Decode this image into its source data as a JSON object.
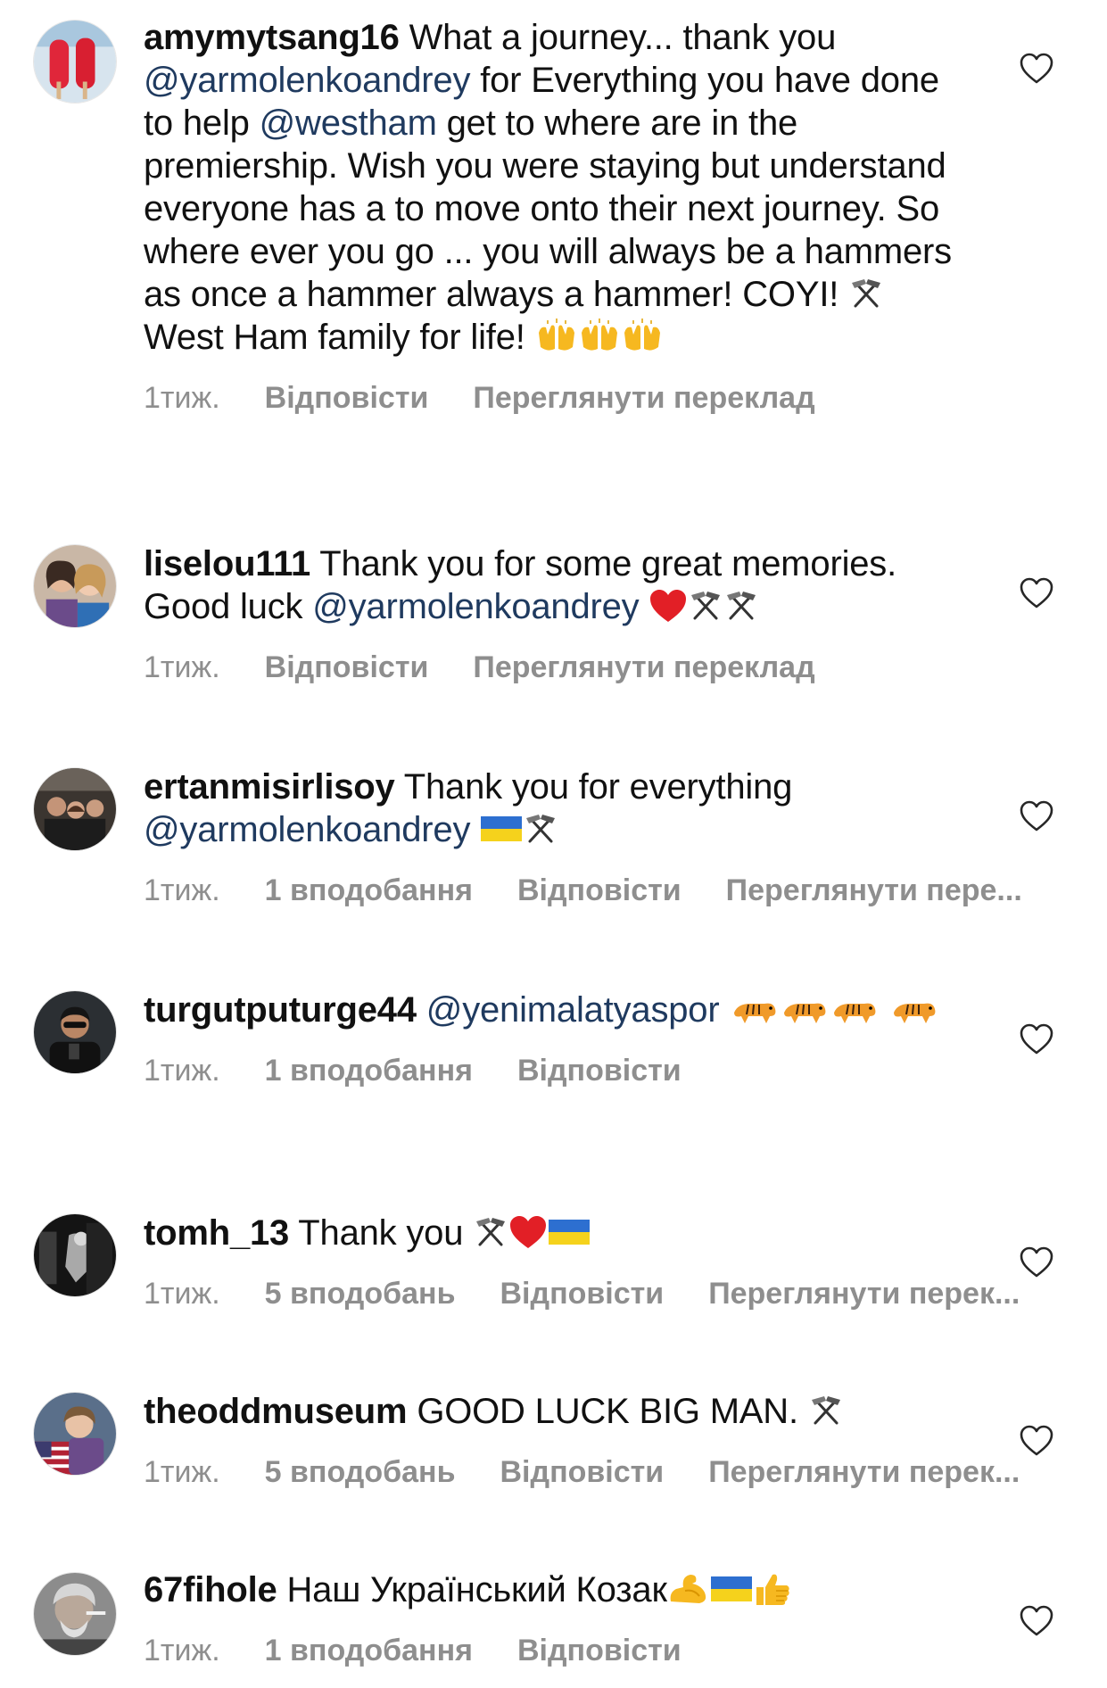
{
  "colors": {
    "text": "#111111",
    "mention": "#1f3a5f",
    "meta": "#8e8e8e",
    "heart_outline": "#262626"
  },
  "comments": [
    {
      "username": "amymytsang16",
      "parts": [
        {
          "t": "text",
          "v": " What a journey... thank you "
        },
        {
          "t": "mention",
          "v": "@yarmolenkoandrey"
        },
        {
          "t": "text",
          "v": " for Everything you have done to help "
        },
        {
          "t": "mention",
          "v": "@westham"
        },
        {
          "t": "text",
          "v": " get to where are in the premiership.  Wish you were staying but understand everyone has a to move onto their next journey.  So where ever you go ... you will always be a hammers as once a hammer always a hammer! COYI! "
        },
        {
          "t": "emoji",
          "v": "hammer-pick-emoji"
        },
        {
          "t": "text",
          "v": " West Ham family for life! "
        },
        {
          "t": "emoji",
          "v": "raised-hands-emoji"
        },
        {
          "t": "emoji",
          "v": "raised-hands-emoji"
        },
        {
          "t": "emoji",
          "v": "raised-hands-emoji"
        }
      ],
      "time": "1тиж.",
      "likes": "",
      "reply": "Відповісти",
      "translate": "Переглянути переклад",
      "avatar_icon": "avatar-popsicles"
    },
    {
      "username": "liselou111",
      "parts": [
        {
          "t": "text",
          "v": " Thank you for some great memories. Good luck "
        },
        {
          "t": "mention",
          "v": "@yarmolenkoandrey"
        },
        {
          "t": "text",
          "v": " "
        },
        {
          "t": "emoji",
          "v": "red-heart-emoji"
        },
        {
          "t": "emoji",
          "v": "hammer-pick-emoji"
        },
        {
          "t": "emoji",
          "v": "hammer-pick-emoji"
        }
      ],
      "time": "1тиж.",
      "likes": "",
      "reply": "Відповісти",
      "translate": "Переглянути переклад",
      "avatar_icon": "avatar-two-women"
    },
    {
      "username": "ertanmisirlisoy",
      "parts": [
        {
          "t": "text",
          "v": " Thank you for everything "
        },
        {
          "t": "mention",
          "v": "@yarmolenkoandrey"
        },
        {
          "t": "text",
          "v": " "
        },
        {
          "t": "emoji",
          "v": "ukraine-flag-emoji"
        },
        {
          "t": "emoji",
          "v": "hammer-pick-emoji"
        }
      ],
      "time": "1тиж.",
      "likes": "1 вподобання",
      "reply": "Відповісти",
      "translate": "Переглянути пере...",
      "avatar_icon": "avatar-group"
    },
    {
      "username": "turgutputurge44",
      "parts": [
        {
          "t": "text",
          "v": " "
        },
        {
          "t": "mention",
          "v": "@yenimalatyaspor"
        },
        {
          "t": "text",
          "v": " "
        },
        {
          "t": "emoji",
          "v": "tiger-emoji"
        },
        {
          "t": "emoji",
          "v": "tiger-emoji"
        },
        {
          "t": "emoji",
          "v": "tiger-emoji"
        },
        {
          "t": "emoji",
          "v": "tiger-emoji"
        }
      ],
      "time": "1тиж.",
      "likes": "1 вподобання",
      "reply": "Відповісти",
      "translate": "",
      "avatar_icon": "avatar-man-sunglasses"
    },
    {
      "username": "tomh_13",
      "parts": [
        {
          "t": "text",
          "v": " Thank you "
        },
        {
          "t": "emoji",
          "v": "hammer-pick-emoji"
        },
        {
          "t": "emoji",
          "v": "red-heart-emoji"
        },
        {
          "t": "emoji",
          "v": "ukraine-flag-emoji"
        }
      ],
      "time": "1тиж.",
      "likes": "5 вподобань",
      "reply": "Відповісти",
      "translate": "Переглянути перек...",
      "avatar_icon": "avatar-dark-room"
    },
    {
      "username": "theoddmuseum",
      "parts": [
        {
          "t": "text",
          "v": " GOOD LUCK BIG MAN. "
        },
        {
          "t": "emoji",
          "v": "hammer-pick-emoji"
        }
      ],
      "time": "1тиж.",
      "likes": "5 вподобань",
      "reply": "Відповісти",
      "translate": "Переглянути перек...",
      "avatar_icon": "avatar-flag-person"
    },
    {
      "username": "67fihole",
      "parts": [
        {
          "t": "text",
          "v": " Наш Український Козак"
        },
        {
          "t": "emoji",
          "v": "flexed-biceps-emoji"
        },
        {
          "t": "emoji",
          "v": "ukraine-flag-emoji"
        },
        {
          "t": "emoji",
          "v": "thumbs-up-emoji"
        }
      ],
      "time": "1тиж.",
      "likes": "1 вподобання",
      "reply": "Відповісти",
      "translate": "",
      "avatar_icon": "avatar-old-man"
    }
  ]
}
